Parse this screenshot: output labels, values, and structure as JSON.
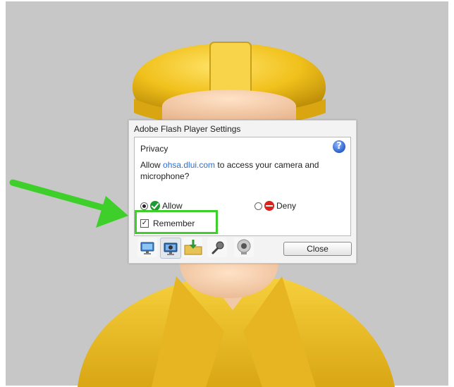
{
  "dialog": {
    "title": "Adobe Flash Player Settings",
    "section_title": "Privacy",
    "message": {
      "prefix": "Allow ",
      "site": "ohsa.dlui.com",
      "suffix": " to access your camera and microphone?"
    },
    "help_icon": "question-mark-icon",
    "options": {
      "allow_label": "Allow",
      "deny_label": "Deny",
      "selected": "allow"
    },
    "remember": {
      "label": "Remember",
      "checked": true
    },
    "tabs": [
      "display-tab",
      "privacy-tab",
      "storage-tab",
      "microphone-tab",
      "camera-tab"
    ],
    "close_label": "Close"
  },
  "colors": {
    "annotation_green": "#3ecf2a",
    "link_blue": "#2a6fd6",
    "allow_green": "#1f9a31",
    "deny_red": "#d8221b",
    "helmet_yellow": "#f1c11c",
    "background_gray": "#c7c7c7"
  }
}
